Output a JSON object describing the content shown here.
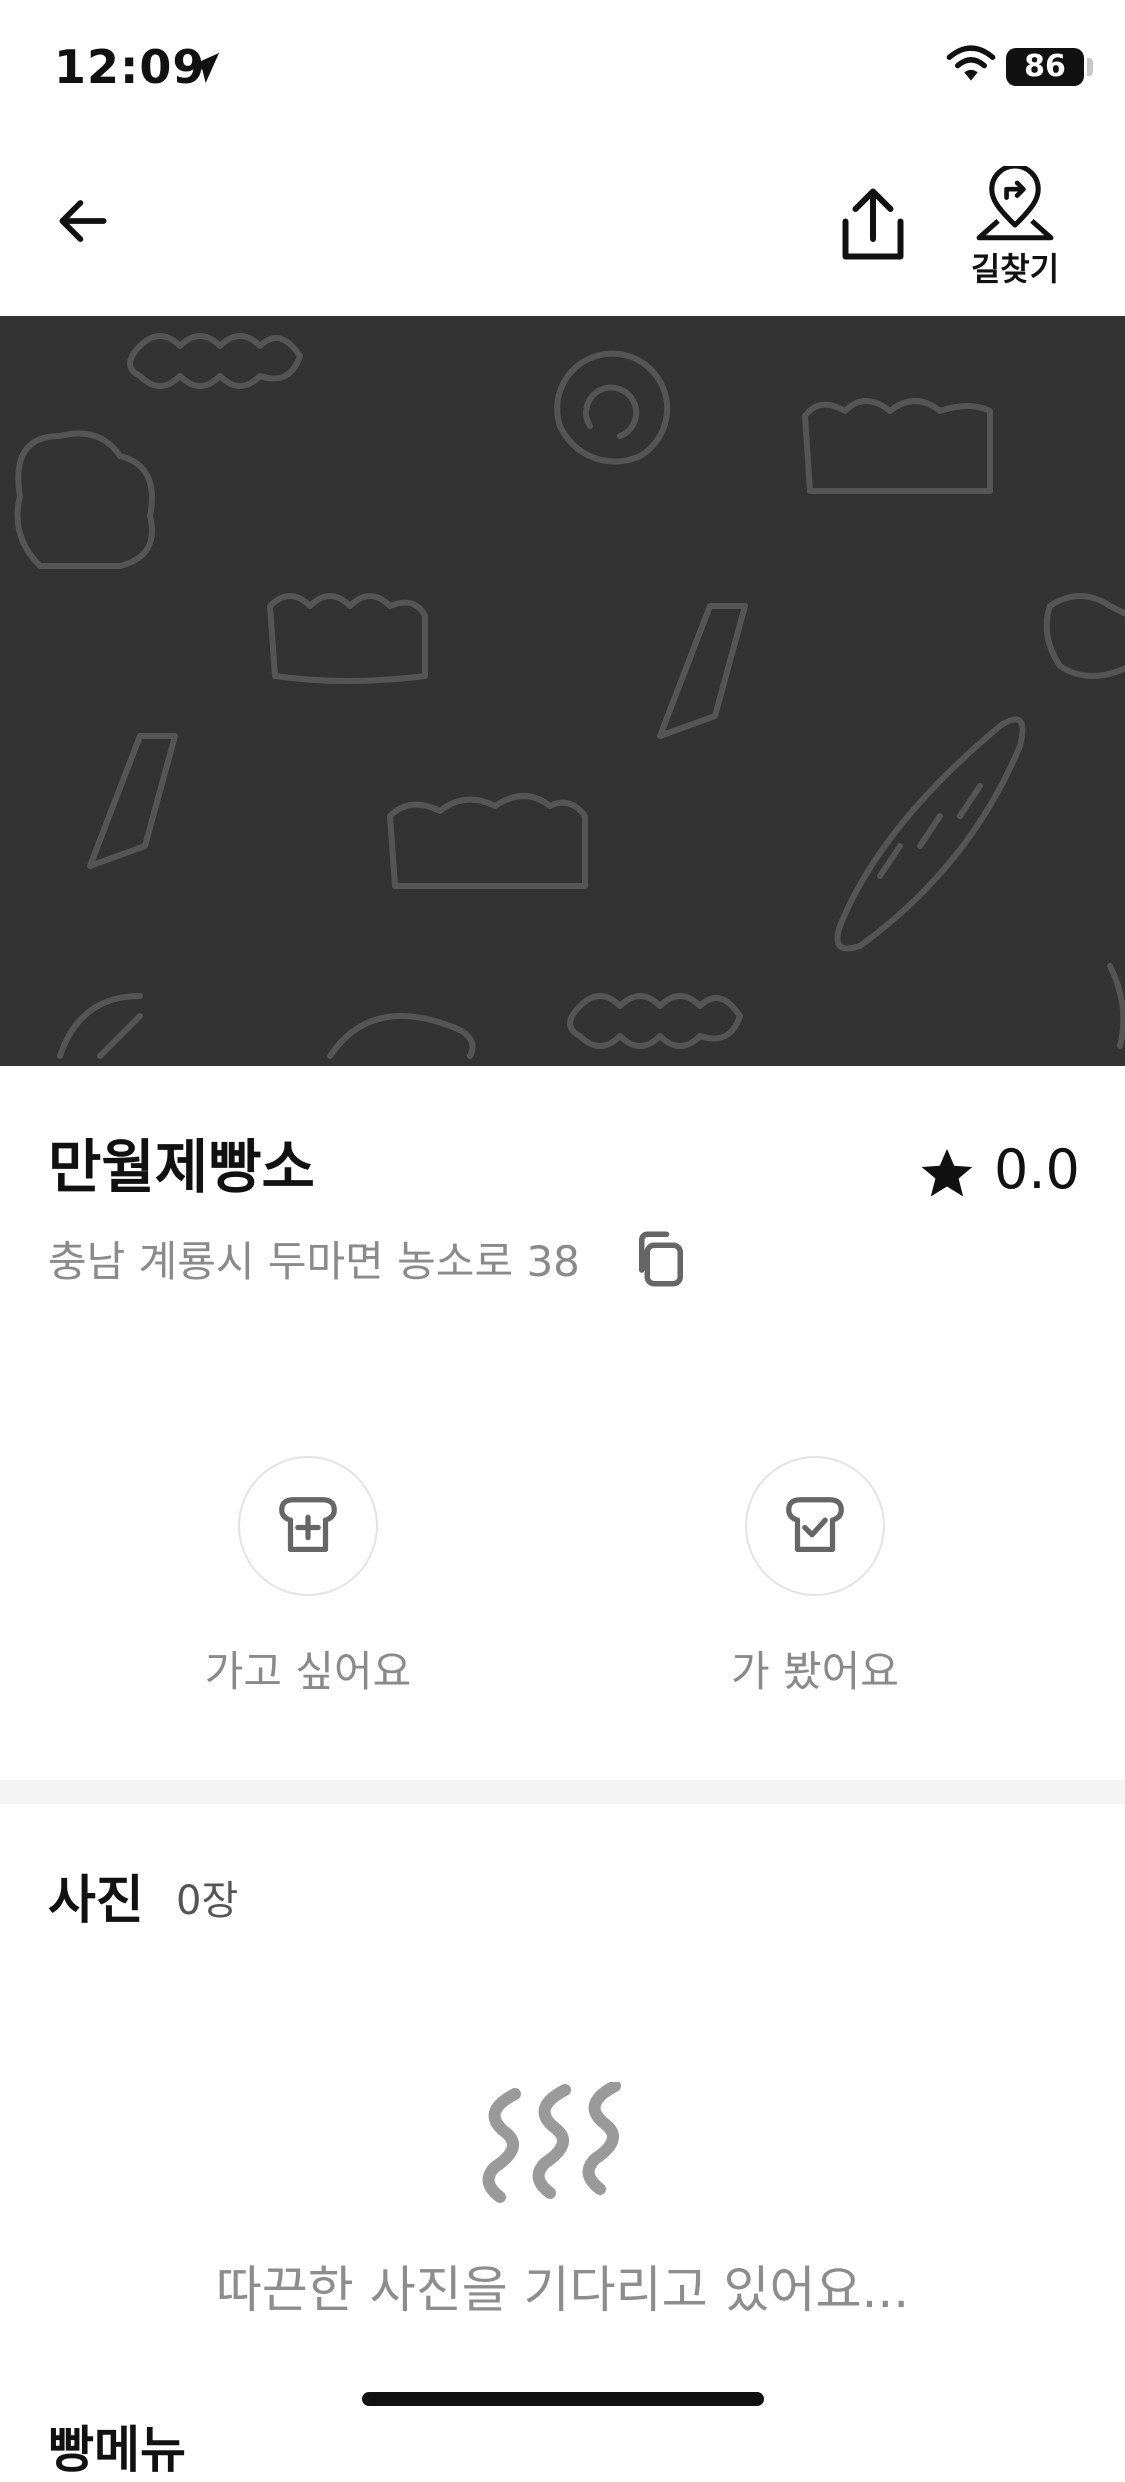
{
  "status_bar": {
    "time": "12:09",
    "battery": "86"
  },
  "nav": {
    "directions_label": "길찾기"
  },
  "place": {
    "name": "만월제빵소",
    "rating": "0.0",
    "address": "충남 계룡시 두마면 농소로 38"
  },
  "actions": {
    "want_label": "가고 싶어요",
    "visited_label": "가 봤어요"
  },
  "photos": {
    "title": "사진",
    "count": "0장",
    "empty_message": "따끈한 사진을 기다리고 있어요..."
  },
  "next_section": {
    "peek_text": "빵메뉴"
  },
  "colors": {
    "hero_background": "#333333",
    "secondary_text": "#8a8a8a",
    "divider": "#f4f4f4"
  }
}
